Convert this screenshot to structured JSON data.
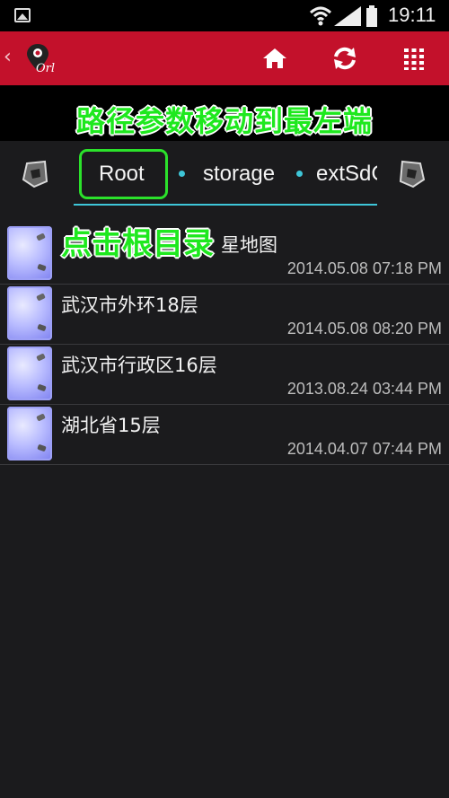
{
  "status_bar": {
    "time": "19:11",
    "icons": [
      "gallery-notification-icon",
      "wifi-icon",
      "signal-icon",
      "battery-icon"
    ]
  },
  "action_bar": {
    "back_glyph": "‹",
    "logo_text": "Orl",
    "buttons": [
      "home-icon",
      "refresh-icon",
      "grid-menu-icon"
    ],
    "color": "#c3112b"
  },
  "banner": {
    "text": "路径参数移动到最左端"
  },
  "path_bar": {
    "crumbs": [
      "Root",
      "storage",
      "extSdC"
    ],
    "accent": "#3ec6d8"
  },
  "hint": {
    "text": "点击根目录"
  },
  "files": [
    {
      "name": "星地图",
      "date": "2014.05.08 07:18 PM"
    },
    {
      "name": "武汉市外环18层",
      "date": "2014.05.08 08:20 PM"
    },
    {
      "name": "武汉市行政区16层",
      "date": "2013.08.24 03:44 PM"
    },
    {
      "name": "湖北省15层",
      "date": "2014.04.07 07:44 PM"
    }
  ],
  "colors": {
    "annotation_green": "#1ee81e",
    "background": "#1b1b1d"
  }
}
